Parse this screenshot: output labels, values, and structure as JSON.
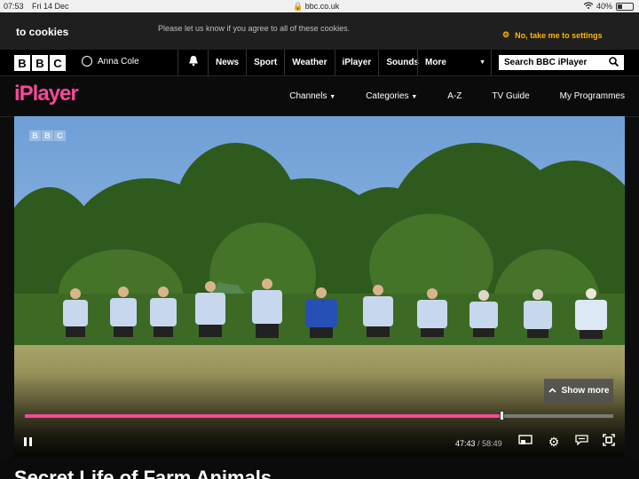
{
  "status_bar": {
    "time": "07:53",
    "date": "Fri 14 Dec",
    "url": "bbc.co.uk",
    "battery": "40%",
    "battery_level": 0.4
  },
  "cookie_banner": {
    "title": "to cookies",
    "message": "Please let us know if you agree to all of these cookies.",
    "settings_link": "No, take me to settings"
  },
  "bbc_nav": {
    "logo_letters": [
      "B",
      "B",
      "C"
    ],
    "account_name": "Anna Cole",
    "links": [
      "News",
      "Sport",
      "Weather",
      "iPlayer",
      "Sounds"
    ],
    "more_label": "More",
    "search_placeholder": "Search BBC iPlayer"
  },
  "iplayer_nav": {
    "logo": "iPlayer",
    "links": {
      "channels": "Channels",
      "categories": "Categories",
      "az": "A-Z",
      "tv_guide": "TV Guide",
      "my_programmes": "My Programmes"
    }
  },
  "player": {
    "channel_logo_letters": [
      "B",
      "B",
      "C"
    ],
    "show_more_label": "Show more",
    "elapsed": "47:43",
    "separator": "/",
    "duration": "58:49",
    "progress_fraction": 0.811
  },
  "programme": {
    "title": "Secret Life of Farm Animals"
  },
  "colors": {
    "brand_pink": "#f54997",
    "cookie_accent": "#ffb400"
  }
}
